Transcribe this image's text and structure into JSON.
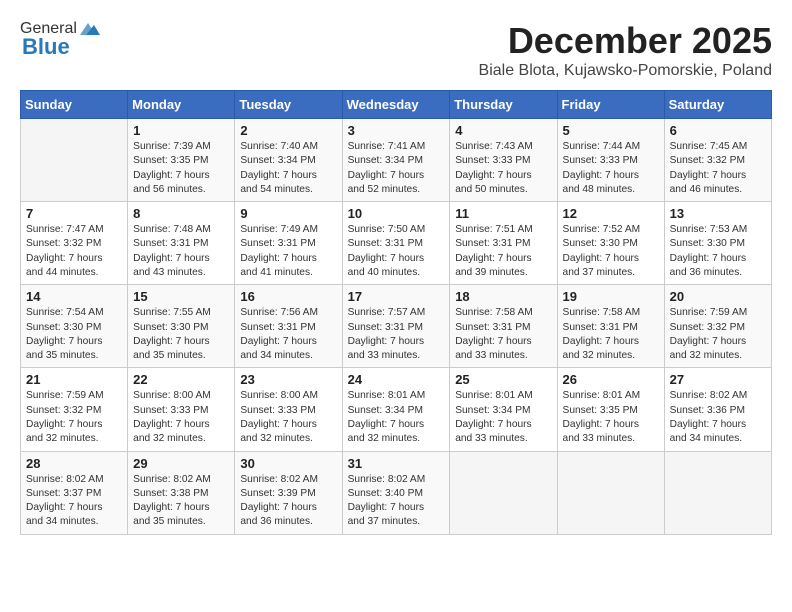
{
  "header": {
    "logo_general": "General",
    "logo_blue": "Blue",
    "month": "December 2025",
    "location": "Biale Blota, Kujawsko-Pomorskie, Poland"
  },
  "days_of_week": [
    "Sunday",
    "Monday",
    "Tuesday",
    "Wednesday",
    "Thursday",
    "Friday",
    "Saturday"
  ],
  "weeks": [
    [
      {
        "day": "",
        "sunrise": "",
        "sunset": "",
        "daylight": ""
      },
      {
        "day": "1",
        "sunrise": "Sunrise: 7:39 AM",
        "sunset": "Sunset: 3:35 PM",
        "daylight": "Daylight: 7 hours and 56 minutes."
      },
      {
        "day": "2",
        "sunrise": "Sunrise: 7:40 AM",
        "sunset": "Sunset: 3:34 PM",
        "daylight": "Daylight: 7 hours and 54 minutes."
      },
      {
        "day": "3",
        "sunrise": "Sunrise: 7:41 AM",
        "sunset": "Sunset: 3:34 PM",
        "daylight": "Daylight: 7 hours and 52 minutes."
      },
      {
        "day": "4",
        "sunrise": "Sunrise: 7:43 AM",
        "sunset": "Sunset: 3:33 PM",
        "daylight": "Daylight: 7 hours and 50 minutes."
      },
      {
        "day": "5",
        "sunrise": "Sunrise: 7:44 AM",
        "sunset": "Sunset: 3:33 PM",
        "daylight": "Daylight: 7 hours and 48 minutes."
      },
      {
        "day": "6",
        "sunrise": "Sunrise: 7:45 AM",
        "sunset": "Sunset: 3:32 PM",
        "daylight": "Daylight: 7 hours and 46 minutes."
      }
    ],
    [
      {
        "day": "7",
        "sunrise": "Sunrise: 7:47 AM",
        "sunset": "Sunset: 3:32 PM",
        "daylight": "Daylight: 7 hours and 44 minutes."
      },
      {
        "day": "8",
        "sunrise": "Sunrise: 7:48 AM",
        "sunset": "Sunset: 3:31 PM",
        "daylight": "Daylight: 7 hours and 43 minutes."
      },
      {
        "day": "9",
        "sunrise": "Sunrise: 7:49 AM",
        "sunset": "Sunset: 3:31 PM",
        "daylight": "Daylight: 7 hours and 41 minutes."
      },
      {
        "day": "10",
        "sunrise": "Sunrise: 7:50 AM",
        "sunset": "Sunset: 3:31 PM",
        "daylight": "Daylight: 7 hours and 40 minutes."
      },
      {
        "day": "11",
        "sunrise": "Sunrise: 7:51 AM",
        "sunset": "Sunset: 3:31 PM",
        "daylight": "Daylight: 7 hours and 39 minutes."
      },
      {
        "day": "12",
        "sunrise": "Sunrise: 7:52 AM",
        "sunset": "Sunset: 3:30 PM",
        "daylight": "Daylight: 7 hours and 37 minutes."
      },
      {
        "day": "13",
        "sunrise": "Sunrise: 7:53 AM",
        "sunset": "Sunset: 3:30 PM",
        "daylight": "Daylight: 7 hours and 36 minutes."
      }
    ],
    [
      {
        "day": "14",
        "sunrise": "Sunrise: 7:54 AM",
        "sunset": "Sunset: 3:30 PM",
        "daylight": "Daylight: 7 hours and 35 minutes."
      },
      {
        "day": "15",
        "sunrise": "Sunrise: 7:55 AM",
        "sunset": "Sunset: 3:30 PM",
        "daylight": "Daylight: 7 hours and 35 minutes."
      },
      {
        "day": "16",
        "sunrise": "Sunrise: 7:56 AM",
        "sunset": "Sunset: 3:31 PM",
        "daylight": "Daylight: 7 hours and 34 minutes."
      },
      {
        "day": "17",
        "sunrise": "Sunrise: 7:57 AM",
        "sunset": "Sunset: 3:31 PM",
        "daylight": "Daylight: 7 hours and 33 minutes."
      },
      {
        "day": "18",
        "sunrise": "Sunrise: 7:58 AM",
        "sunset": "Sunset: 3:31 PM",
        "daylight": "Daylight: 7 hours and 33 minutes."
      },
      {
        "day": "19",
        "sunrise": "Sunrise: 7:58 AM",
        "sunset": "Sunset: 3:31 PM",
        "daylight": "Daylight: 7 hours and 32 minutes."
      },
      {
        "day": "20",
        "sunrise": "Sunrise: 7:59 AM",
        "sunset": "Sunset: 3:32 PM",
        "daylight": "Daylight: 7 hours and 32 minutes."
      }
    ],
    [
      {
        "day": "21",
        "sunrise": "Sunrise: 7:59 AM",
        "sunset": "Sunset: 3:32 PM",
        "daylight": "Daylight: 7 hours and 32 minutes."
      },
      {
        "day": "22",
        "sunrise": "Sunrise: 8:00 AM",
        "sunset": "Sunset: 3:33 PM",
        "daylight": "Daylight: 7 hours and 32 minutes."
      },
      {
        "day": "23",
        "sunrise": "Sunrise: 8:00 AM",
        "sunset": "Sunset: 3:33 PM",
        "daylight": "Daylight: 7 hours and 32 minutes."
      },
      {
        "day": "24",
        "sunrise": "Sunrise: 8:01 AM",
        "sunset": "Sunset: 3:34 PM",
        "daylight": "Daylight: 7 hours and 32 minutes."
      },
      {
        "day": "25",
        "sunrise": "Sunrise: 8:01 AM",
        "sunset": "Sunset: 3:34 PM",
        "daylight": "Daylight: 7 hours and 33 minutes."
      },
      {
        "day": "26",
        "sunrise": "Sunrise: 8:01 AM",
        "sunset": "Sunset: 3:35 PM",
        "daylight": "Daylight: 7 hours and 33 minutes."
      },
      {
        "day": "27",
        "sunrise": "Sunrise: 8:02 AM",
        "sunset": "Sunset: 3:36 PM",
        "daylight": "Daylight: 7 hours and 34 minutes."
      }
    ],
    [
      {
        "day": "28",
        "sunrise": "Sunrise: 8:02 AM",
        "sunset": "Sunset: 3:37 PM",
        "daylight": "Daylight: 7 hours and 34 minutes."
      },
      {
        "day": "29",
        "sunrise": "Sunrise: 8:02 AM",
        "sunset": "Sunset: 3:38 PM",
        "daylight": "Daylight: 7 hours and 35 minutes."
      },
      {
        "day": "30",
        "sunrise": "Sunrise: 8:02 AM",
        "sunset": "Sunset: 3:39 PM",
        "daylight": "Daylight: 7 hours and 36 minutes."
      },
      {
        "day": "31",
        "sunrise": "Sunrise: 8:02 AM",
        "sunset": "Sunset: 3:40 PM",
        "daylight": "Daylight: 7 hours and 37 minutes."
      },
      {
        "day": "",
        "sunrise": "",
        "sunset": "",
        "daylight": ""
      },
      {
        "day": "",
        "sunrise": "",
        "sunset": "",
        "daylight": ""
      },
      {
        "day": "",
        "sunrise": "",
        "sunset": "",
        "daylight": ""
      }
    ]
  ]
}
